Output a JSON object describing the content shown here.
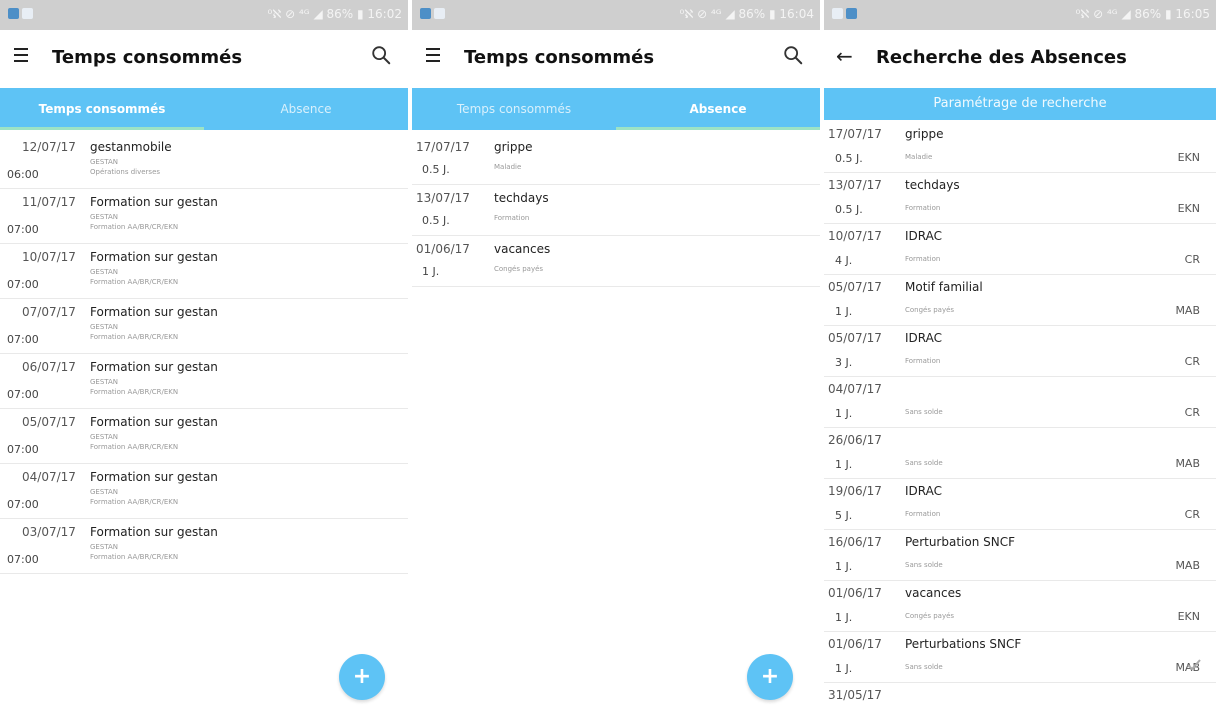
{
  "screens": [
    {
      "status": {
        "right": "⁰ℵ ⊘ ⁴ᴳ ◢ 86% ▮ 16:02"
      },
      "appbar": {
        "title": "Temps consommés"
      },
      "tabs": [
        {
          "label": "Temps consommés",
          "active": true
        },
        {
          "label": "Absence",
          "active": false
        }
      ],
      "rows": [
        {
          "date": "12/07/17",
          "title": "gestanmobile",
          "value": "06:00",
          "sub1": "GESTAN",
          "sub2": "Opérations diverses"
        },
        {
          "date": "11/07/17",
          "title": "Formation sur gestan",
          "value": "07:00",
          "sub1": "GESTAN",
          "sub2": "Formation AA/BR/CR/EKN"
        },
        {
          "date": "10/07/17",
          "title": "Formation sur gestan",
          "value": "07:00",
          "sub1": "GESTAN",
          "sub2": "Formation AA/BR/CR/EKN"
        },
        {
          "date": "07/07/17",
          "title": "Formation sur gestan",
          "value": "07:00",
          "sub1": "GESTAN",
          "sub2": "Formation AA/BR/CR/EKN"
        },
        {
          "date": "06/07/17",
          "title": "Formation sur gestan",
          "value": "07:00",
          "sub1": "GESTAN",
          "sub2": "Formation AA/BR/CR/EKN"
        },
        {
          "date": "05/07/17",
          "title": "Formation sur gestan",
          "value": "07:00",
          "sub1": "GESTAN",
          "sub2": "Formation AA/BR/CR/EKN"
        },
        {
          "date": "04/07/17",
          "title": "Formation sur gestan",
          "value": "07:00",
          "sub1": "GESTAN",
          "sub2": "Formation AA/BR/CR/EKN"
        },
        {
          "date": "03/07/17",
          "title": "Formation sur gestan",
          "value": "07:00",
          "sub1": "GESTAN",
          "sub2": "Formation AA/BR/CR/EKN"
        }
      ],
      "fab": {
        "label": "+"
      }
    },
    {
      "status": {
        "right": "⁰ℵ ⊘ ⁴ᴳ ◢ 86% ▮ 16:04"
      },
      "appbar": {
        "title": "Temps consommés"
      },
      "tabs": [
        {
          "label": "Temps consommés",
          "active": false
        },
        {
          "label": "Absence",
          "active": true
        }
      ],
      "rows": [
        {
          "date": "17/07/17",
          "title": "grippe",
          "value": "0.5 J.",
          "type": "Maladie"
        },
        {
          "date": "13/07/17",
          "title": "techdays",
          "value": "0.5 J.",
          "type": "Formation"
        },
        {
          "date": "01/06/17",
          "title": "vacances",
          "value": "1 J.",
          "type": "Congés payés"
        }
      ],
      "fab": {
        "label": "+"
      }
    },
    {
      "status": {
        "right": "⁰ℵ ⊘ ⁴ᴳ ◢ 86% ▮ 16:05"
      },
      "appbar": {
        "title": "Recherche des Absences"
      },
      "subheader": "Paramétrage de recherche",
      "rows": [
        {
          "date": "17/07/17",
          "title": "grippe",
          "value": "0.5 J.",
          "type": "Maladie",
          "code": "EKN"
        },
        {
          "date": "13/07/17",
          "title": "techdays",
          "value": "0.5 J.",
          "type": "Formation",
          "code": "EKN"
        },
        {
          "date": "10/07/17",
          "title": "IDRAC",
          "value": "4 J.",
          "type": "Formation",
          "code": "CR"
        },
        {
          "date": "05/07/17",
          "title": "Motif familial",
          "value": "1 J.",
          "type": "Congés payés",
          "code": "MAB"
        },
        {
          "date": "05/07/17",
          "title": "IDRAC",
          "value": "3 J.",
          "type": "Formation",
          "code": "CR"
        },
        {
          "date": "04/07/17",
          "title": "",
          "value": "1 J.",
          "type": "Sans solde",
          "code": "CR"
        },
        {
          "date": "26/06/17",
          "title": "",
          "value": "1 J.",
          "type": "Sans solde",
          "code": "MAB"
        },
        {
          "date": "19/06/17",
          "title": "IDRAC",
          "value": "5 J.",
          "type": "Formation",
          "code": "CR"
        },
        {
          "date": "16/06/17",
          "title": "Perturbation SNCF",
          "value": "1 J.",
          "type": "Sans solde",
          "code": "MAB"
        },
        {
          "date": "01/06/17",
          "title": "vacances",
          "value": "1 J.",
          "type": "Congés payés",
          "code": "EKN"
        },
        {
          "date": "01/06/17",
          "title": "Perturbations SNCF",
          "value": "1 J.",
          "type": "Sans solde",
          "code": "MAB"
        },
        {
          "date": "31/05/17",
          "title": "",
          "value": "",
          "type": "",
          "code": ""
        }
      ]
    }
  ],
  "colors": {
    "accent": "#5ec3f5",
    "tab_indicator": "#9ce3c5",
    "statusbar": "#cfcfcf"
  },
  "icons": [
    "menu-icon",
    "search-icon",
    "back-arrow-icon",
    "add-icon",
    "check-icon"
  ]
}
